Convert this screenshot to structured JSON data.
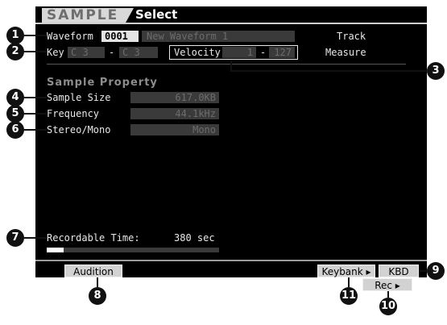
{
  "header": {
    "mode_tab": "SAMPLE",
    "page_title": "Select"
  },
  "waveform": {
    "label": "Waveform",
    "number": "0001",
    "name": "New Waveform 1"
  },
  "right_labels": {
    "track": "Track",
    "measure": "Measure"
  },
  "key": {
    "label": "Key",
    "low": "C  3",
    "dash": "-",
    "high": "C  3"
  },
  "velocity": {
    "label": "Velocity",
    "low": "1",
    "dash": "-",
    "high": "127"
  },
  "sample_property": {
    "title": "Sample Property",
    "size_label": "Sample Size",
    "size_value": "617.0KB",
    "frequency_label": "Frequency",
    "frequency_value": "44.1kHz",
    "stereo_label": "Stereo/Mono",
    "stereo_value": "Mono"
  },
  "recordable": {
    "label": "Recordable Time:",
    "value": "380 sec",
    "meter_fraction": 0.1
  },
  "buttons": {
    "audition": "Audition",
    "keybank": "Keybank ▸",
    "kbd": "KBD",
    "rec": "Rec ▸"
  },
  "callouts": [
    "1",
    "2",
    "3",
    "4",
    "5",
    "6",
    "7",
    "8",
    "9",
    "10",
    "11"
  ],
  "colors": {
    "screen_bg": "#000000",
    "field_bg": "#3a3a3a",
    "selected_bg": "#e4e4e4",
    "dim_text": "#6c6c6c"
  }
}
